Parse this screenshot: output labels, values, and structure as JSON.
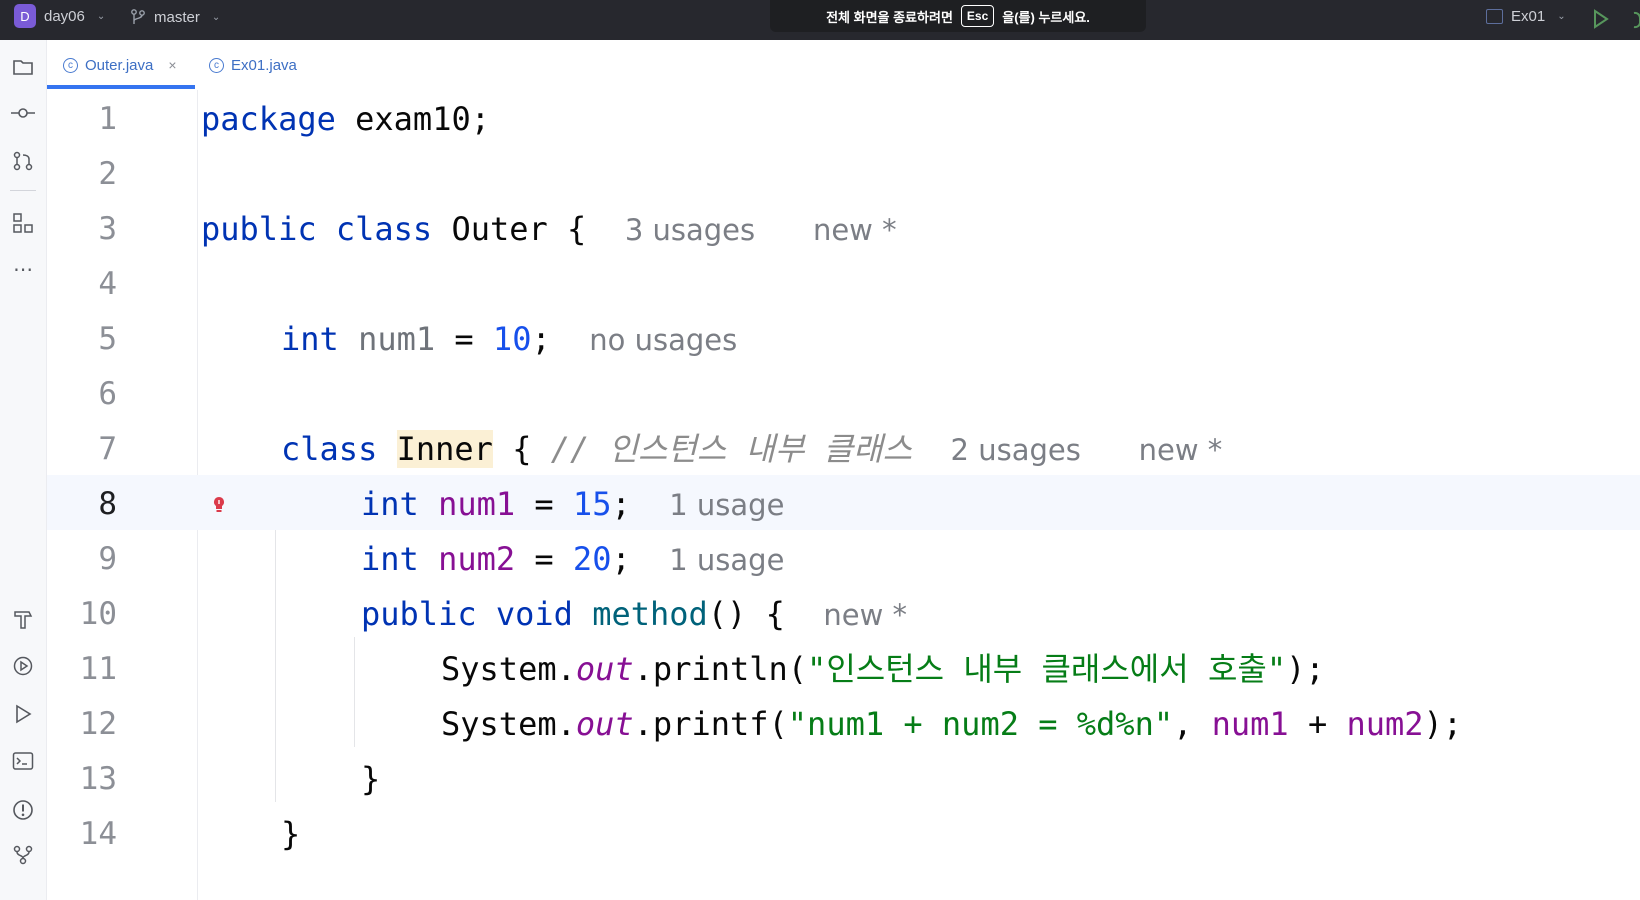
{
  "titlebar": {
    "project_initial": "D",
    "project_name": "day06",
    "branch": "master",
    "fullscreen_msg_before": "전체 화면을 종료하려면",
    "esc_key": "Esc",
    "fullscreen_msg_after": "을(를) 누르세요.",
    "run_config": "Ex01"
  },
  "tabs": [
    {
      "label": "Outer.java",
      "close": "×"
    },
    {
      "label": "Ex01.java"
    }
  ],
  "editor": {
    "line_numbers": [
      "1",
      "2",
      "3",
      "4",
      "5",
      "6",
      "7",
      "8",
      "9",
      "10",
      "11",
      "12",
      "13",
      "14"
    ],
    "l1": {
      "kw": "package",
      "rest": " exam10;"
    },
    "l3": {
      "kw1": "public",
      "kw2": "class",
      "name": "Outer",
      "brace": " {",
      "hint_usages": "3 usages",
      "hint_new": "new *"
    },
    "l5": {
      "kw": "int",
      "var": "num1",
      "eq": " = ",
      "num": "10",
      "semi": ";",
      "hint": "no usages"
    },
    "l7": {
      "kw": "class",
      "name": "Inner",
      "brace": " { ",
      "comment": "// 인스턴스 내부 클래스",
      "hint_usages": "2 usages",
      "hint_new": "new *"
    },
    "l8": {
      "kw": "int",
      "var": "num1",
      "eq": " = ",
      "num": "15",
      "semi": ";",
      "hint": "1 usage"
    },
    "l9": {
      "kw": "int",
      "var": "num2",
      "eq": " = ",
      "num": "20",
      "semi": ";",
      "hint": "1 usage"
    },
    "l10": {
      "kw1": "public",
      "kw2": "void",
      "method": "method",
      "rest": "() {",
      "hint": "new *"
    },
    "l11": {
      "cls": "System.",
      "out": "out",
      "call": ".println(",
      "str": "\"인스턴스 내부 클래스에서 호출\"",
      "end": ");"
    },
    "l12": {
      "cls": "System.",
      "out": "out",
      "call": ".printf(",
      "str": "\"num1 + num2 = %d%n\"",
      "comma": ", ",
      "a": "num1",
      "plus": " + ",
      "b": "num2",
      "end": ");"
    },
    "l13": {
      "brace": "}"
    },
    "l14": {
      "brace": "}"
    }
  },
  "colors": {
    "keyword": "#0033b3",
    "field": "#871094",
    "number": "#1750eb",
    "string": "#067d17",
    "accent": "#3574f0"
  },
  "icons": [
    "project-folder-icon",
    "commit-icon",
    "pull-requests-icon",
    "structure-icon",
    "more-icon",
    "build-icon",
    "services-icon",
    "run-icon",
    "terminal-icon",
    "problems-icon",
    "git-icon",
    "run-button-icon",
    "debug-icon",
    "class-file-icon",
    "intention-bulb-icon"
  ]
}
